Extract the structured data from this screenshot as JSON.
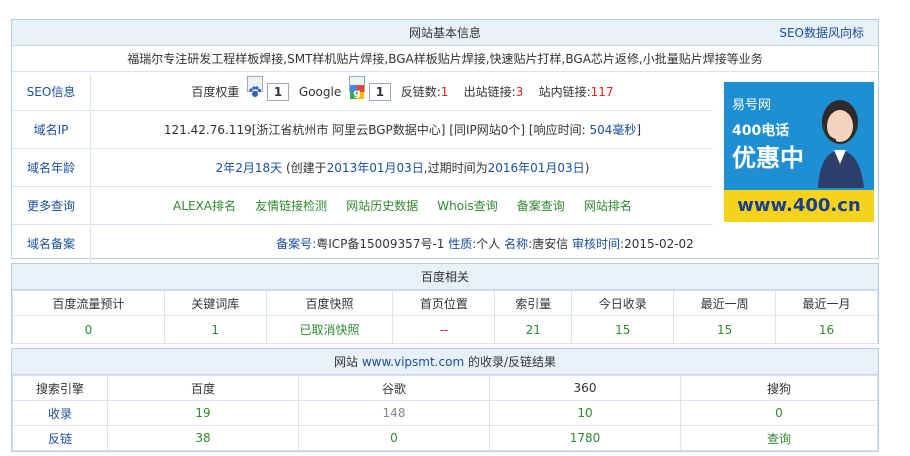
{
  "site_info": {
    "title": "网站基本信息",
    "seo_link": "SEO数据风向标",
    "description": "福瑞尔专注研发工程样板焊接,SMT样机贴片焊接,BGA样板贴片焊接,快速贴片打样,BGA芯片返修,小批量贴片焊接等业务",
    "seo": {
      "label": "SEO信息",
      "baidu_weight_label": "百度权重",
      "baidu_weight": "1",
      "google_label": "Google",
      "google_pr": "1",
      "backlinks_label": "反链数:",
      "backlinks": "1",
      "outlinks_label": "出站链接:",
      "outlinks": "3",
      "inlinks_label": "站内链接:",
      "inlinks": "117"
    },
    "ip": {
      "label": "域名IP",
      "ip": "121.42.76.119",
      "location": "[浙江省杭州市 阿里云BGP数据中心]",
      "same_ip": "[同IP网站0个]",
      "resp_label": "[响应时间:",
      "resp_value": "504毫秒",
      "resp_end": "]"
    },
    "age": {
      "label": "域名年龄",
      "age": "2年2月18天",
      "created_label": "(创建于",
      "created": "2013年01月03日",
      "expire_label": ",过期时间为",
      "expire": "2016年01月03日",
      "end": ")"
    },
    "more": {
      "label": "更多查询",
      "links": [
        "ALEXA排名",
        "友情链接检测",
        "网站历史数据",
        "Whois查询",
        "备案查询",
        "网站排名"
      ]
    },
    "icp": {
      "label": "域名备案",
      "no_label": "备案号:",
      "no": "粤ICP备15009357号-1",
      "nature_label": "性质:",
      "nature": "个人",
      "name_label": "名称:",
      "name": "唐安信",
      "date_label": "审核时间:",
      "date": "2015-02-02"
    }
  },
  "ad": {
    "brand": "易号网",
    "line1": "400电话",
    "line2": "优惠中",
    "url": "www.400.cn"
  },
  "baidu": {
    "title": "百度相关",
    "headers": [
      "百度流量预计",
      "关键词库",
      "百度快照",
      "首页位置",
      "索引量",
      "今日收录",
      "最近一周",
      "最近一月"
    ],
    "values": [
      "0",
      "1",
      "已取消快照",
      "--",
      "21",
      "15",
      "15",
      "16"
    ]
  },
  "index": {
    "title_prefix": "网站",
    "domain": "www.vipsmt.com",
    "title_suffix": "的收录/反链结果",
    "headers": [
      "搜索引擎",
      "百度",
      "谷歌",
      "360",
      "搜狗"
    ],
    "rows": [
      {
        "label": "收录",
        "values": [
          "19",
          "148",
          "10",
          "0"
        ]
      },
      {
        "label": "反链",
        "values": [
          "38",
          "0",
          "1780",
          "查询"
        ]
      }
    ]
  },
  "colors": {
    "header_bg": "#e8f0fa",
    "border": "#b9cde5",
    "link": "#1a4fa0",
    "green": "#2e8b2e",
    "red": "#e02222",
    "ad_blue": "#1e8fd3",
    "ad_yellow": "#f5d31a"
  }
}
